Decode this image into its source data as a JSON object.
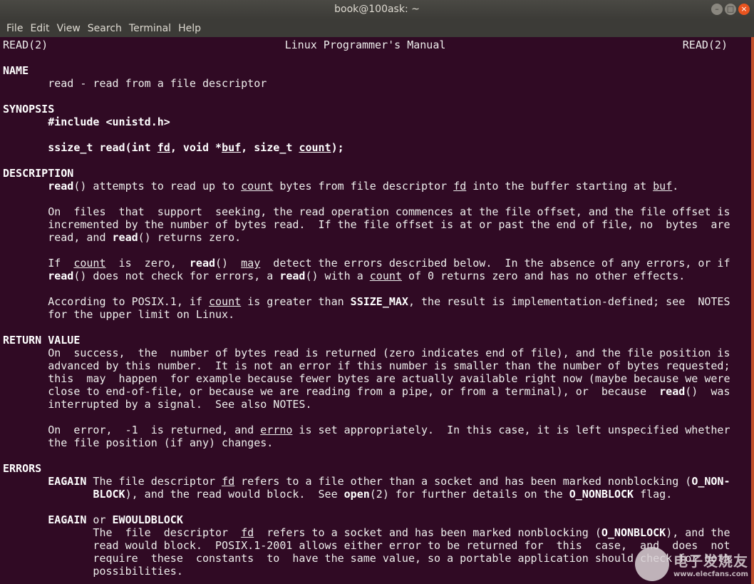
{
  "window": {
    "title": "book@100ask: ~",
    "buttons": [
      "minimize",
      "maximize",
      "close"
    ]
  },
  "menu": [
    "File",
    "Edit",
    "View",
    "Search",
    "Terminal",
    "Help"
  ],
  "header": {
    "left": "READ(2)",
    "center": "Linux Programmer's Manual",
    "right": "READ(2)"
  },
  "lines": [
    [],
    [
      [
        "NAME",
        "b"
      ]
    ],
    [
      [
        "       read - read from a file descriptor",
        ""
      ]
    ],
    [],
    [
      [
        "SYNOPSIS",
        "b"
      ]
    ],
    [
      [
        "       ",
        ""
      ],
      [
        "#include <unistd.h>",
        "b"
      ]
    ],
    [],
    [
      [
        "       ",
        ""
      ],
      [
        "ssize_t read(int ",
        "b"
      ],
      [
        "fd",
        "bu"
      ],
      [
        ", void *",
        "b"
      ],
      [
        "buf",
        "bu"
      ],
      [
        ", size_t ",
        "b"
      ],
      [
        "count",
        "bu"
      ],
      [
        ");",
        "b"
      ]
    ],
    [],
    [
      [
        "DESCRIPTION",
        "b"
      ]
    ],
    [
      [
        "       ",
        ""
      ],
      [
        "read",
        "b"
      ],
      [
        "() attempts to read up to ",
        ""
      ],
      [
        "count",
        "u"
      ],
      [
        " bytes from file descriptor ",
        ""
      ],
      [
        "fd",
        "u"
      ],
      [
        " into the buffer starting at ",
        ""
      ],
      [
        "buf",
        "u"
      ],
      [
        ".",
        ""
      ]
    ],
    [],
    [
      [
        "       On  files  that  support  seeking, the read operation commences at the file offset, and the file offset is",
        ""
      ]
    ],
    [
      [
        "       incremented by the number of bytes read.  If the file offset is at or past the end of file, no  bytes  are",
        ""
      ]
    ],
    [
      [
        "       read, and ",
        ""
      ],
      [
        "read",
        "b"
      ],
      [
        "() returns zero.",
        ""
      ]
    ],
    [],
    [
      [
        "       If  ",
        ""
      ],
      [
        "count",
        "u"
      ],
      [
        "  is  zero,  ",
        ""
      ],
      [
        "read",
        "b"
      ],
      [
        "()  ",
        ""
      ],
      [
        "may",
        "u"
      ],
      [
        "  detect the errors described below.  In the absence of any errors, or if",
        ""
      ]
    ],
    [
      [
        "       ",
        ""
      ],
      [
        "read",
        "b"
      ],
      [
        "() does not check for errors, a ",
        ""
      ],
      [
        "read",
        "b"
      ],
      [
        "() with a ",
        ""
      ],
      [
        "count",
        "u"
      ],
      [
        " of 0 returns zero and has no other effects.",
        ""
      ]
    ],
    [],
    [
      [
        "       According to POSIX.1, if ",
        ""
      ],
      [
        "count",
        "u"
      ],
      [
        " is greater than ",
        ""
      ],
      [
        "SSIZE_MAX",
        "b"
      ],
      [
        ", the result is implementation-defined; see  NOTES",
        ""
      ]
    ],
    [
      [
        "       for the upper limit on Linux.",
        ""
      ]
    ],
    [],
    [
      [
        "RETURN VALUE",
        "b"
      ]
    ],
    [
      [
        "       On  success,  the  number of bytes read is returned (zero indicates end of file), and the file position is",
        ""
      ]
    ],
    [
      [
        "       advanced by this number.  It is not an error if this number is smaller than the number of bytes requested;",
        ""
      ]
    ],
    [
      [
        "       this  may  happen  for example because fewer bytes are actually available right now (maybe because we were",
        ""
      ]
    ],
    [
      [
        "       close to end-of-file, or because we are reading from a pipe, or from a terminal), or  because  ",
        ""
      ],
      [
        "read",
        "b"
      ],
      [
        "()  was",
        ""
      ]
    ],
    [
      [
        "       interrupted by a signal.  See also NOTES.",
        ""
      ]
    ],
    [],
    [
      [
        "       On  error,  -1  is returned, and ",
        ""
      ],
      [
        "errno",
        "u"
      ],
      [
        " is set appropriately.  In this case, it is left unspecified whether",
        ""
      ]
    ],
    [
      [
        "       the file position (if any) changes.",
        ""
      ]
    ],
    [],
    [
      [
        "ERRORS",
        "b"
      ]
    ],
    [
      [
        "       ",
        ""
      ],
      [
        "EAGAIN",
        "b"
      ],
      [
        " The file descriptor ",
        ""
      ],
      [
        "fd",
        "u"
      ],
      [
        " refers to a file other than a socket and has been marked nonblocking (",
        ""
      ],
      [
        "O_NON-",
        "b"
      ]
    ],
    [
      [
        "              ",
        ""
      ],
      [
        "BLOCK",
        "b"
      ],
      [
        "), and the read would block.  See ",
        ""
      ],
      [
        "open",
        "b"
      ],
      [
        "(2) for further details on the ",
        ""
      ],
      [
        "O_NONBLOCK",
        "b"
      ],
      [
        " flag.",
        ""
      ]
    ],
    [],
    [
      [
        "       ",
        ""
      ],
      [
        "EAGAIN",
        "b"
      ],
      [
        " or ",
        ""
      ],
      [
        "EWOULDBLOCK",
        "b"
      ]
    ],
    [
      [
        "              The  file  descriptor  ",
        ""
      ],
      [
        "fd",
        "u"
      ],
      [
        "  refers to a socket and has been marked nonblocking (",
        ""
      ],
      [
        "O_NONBLOCK",
        "b"
      ],
      [
        "), and the",
        ""
      ]
    ],
    [
      [
        "              read would block.  POSIX.1-2001 allows either error to be returned for  this  case,  and  does  not",
        ""
      ]
    ],
    [
      [
        "              require  these  constants  to  have the same value, so a portable application should check for both",
        ""
      ]
    ],
    [
      [
        "              possibilities.",
        ""
      ]
    ]
  ],
  "watermark": {
    "brand": "电子发烧友",
    "url": "www.elecfans.com"
  },
  "colors": {
    "terminal_bg": "#300a24",
    "titlebar": "#3c3b37",
    "close_button": "#e9541f",
    "text": "#eeeeec"
  }
}
